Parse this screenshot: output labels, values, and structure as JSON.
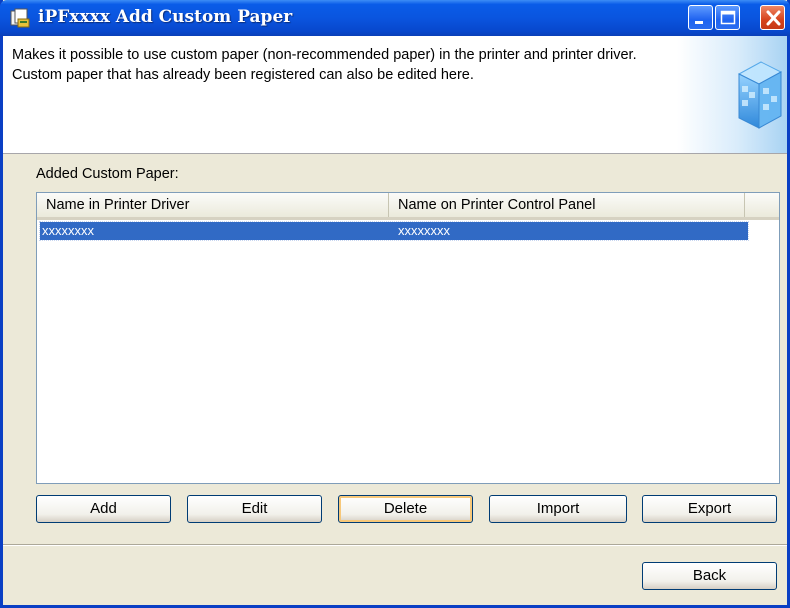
{
  "window": {
    "title": "iPFxxxx  Add Custom Paper",
    "controls": {
      "minimize": "minimize-icon",
      "maximize": "maximize-icon",
      "close": "close-icon"
    }
  },
  "header": {
    "description": "Makes it possible to use custom paper (non-recommended paper) in the printer and printer driver. Custom paper that has already been registered can also be edited here."
  },
  "list": {
    "label": "Added Custom Paper:",
    "columns": [
      "Name in Printer Driver",
      "Name on Printer Control Panel"
    ],
    "rows": [
      {
        "driver_name": "xxxxxxxx",
        "panel_name": "xxxxxxxx",
        "selected": true
      }
    ]
  },
  "buttons": {
    "add": "Add",
    "edit": "Edit",
    "delete": "Delete",
    "import": "Import",
    "export": "Export",
    "back": "Back"
  },
  "colors": {
    "titlebar": "#0a55df",
    "selection": "#316ac5",
    "dialog_bg": "#ece9d8"
  }
}
